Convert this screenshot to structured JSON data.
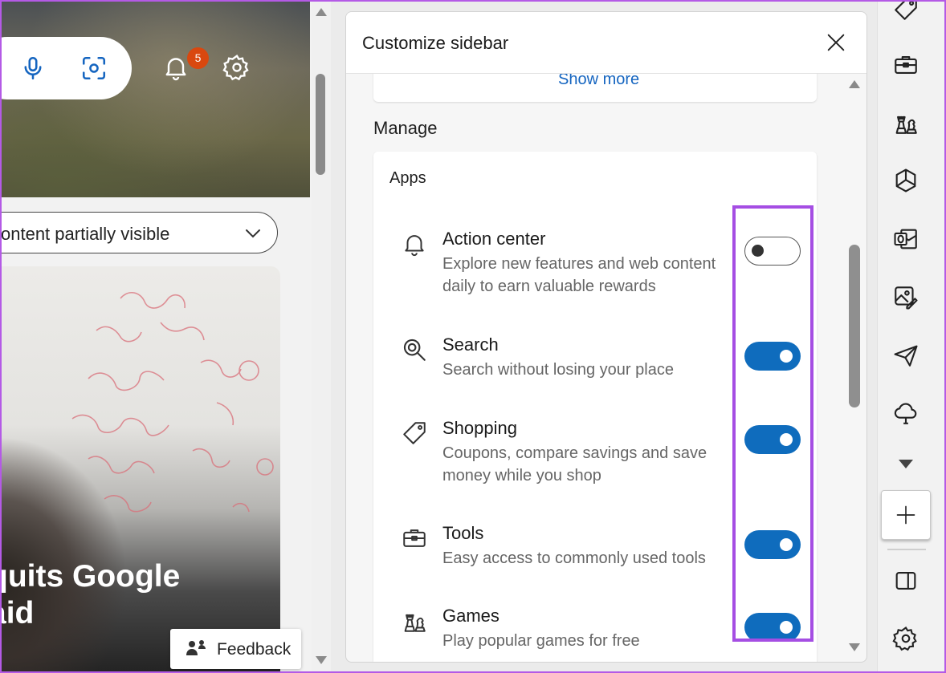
{
  "page": {
    "notification_count": "5",
    "visibility_label": "ontent partially visible",
    "headline_line1": "quits Google",
    "headline_line2": "aid",
    "feedback_label": "Feedback"
  },
  "panel": {
    "title": "Customize sidebar",
    "show_more_label": "Show more",
    "section_title": "Manage",
    "apps_title": "Apps",
    "items": [
      {
        "name": "Action center",
        "desc": "Explore new features and web content daily to earn valuable rewards",
        "icon": "bell-icon",
        "enabled": false
      },
      {
        "name": "Search",
        "desc": "Search without losing your place",
        "icon": "search-icon",
        "enabled": true
      },
      {
        "name": "Shopping",
        "desc": "Coupons, compare savings and save money while you shop",
        "icon": "tag-icon",
        "enabled": true
      },
      {
        "name": "Tools",
        "desc": "Easy access to commonly used tools",
        "icon": "toolbox-icon",
        "enabled": true
      },
      {
        "name": "Games",
        "desc": "Play popular games for free",
        "icon": "chess-icon",
        "enabled": true
      }
    ]
  },
  "colors": {
    "accent": "#0f6cbd",
    "highlight": "#a54ee3",
    "badge": "#d9480f"
  },
  "sidebar_icons": [
    "tag-icon",
    "toolbox-icon",
    "chess-icon",
    "m365-icon",
    "outlook-icon",
    "image-creator-icon",
    "send-icon",
    "cloud-icon",
    "chevron-down-icon",
    "add-icon",
    "split-screen-icon",
    "settings-icon"
  ]
}
